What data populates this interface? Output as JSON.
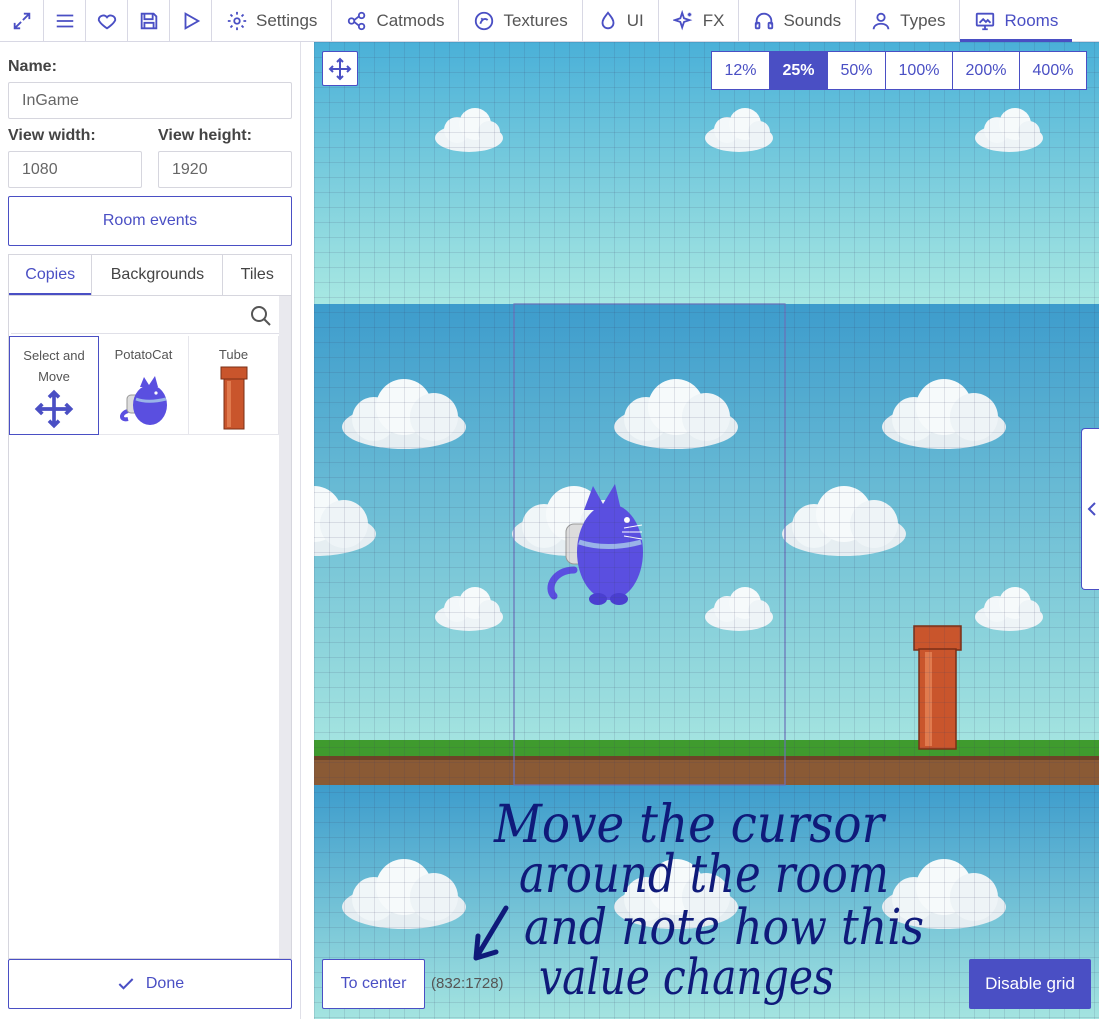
{
  "toolbar": {
    "icons": [
      "expand-icon",
      "menu-icon",
      "heart-icon",
      "save-icon",
      "play-icon"
    ],
    "tabs": [
      {
        "label": "Settings",
        "icon": "gear-icon"
      },
      {
        "label": "Catmods",
        "icon": "modules-icon"
      },
      {
        "label": "Textures",
        "icon": "texture-icon"
      },
      {
        "label": "UI",
        "icon": "droplet-icon"
      },
      {
        "label": "FX",
        "icon": "sparkle-icon"
      },
      {
        "label": "Sounds",
        "icon": "headphones-icon"
      },
      {
        "label": "Types",
        "icon": "user-icon"
      },
      {
        "label": "Rooms",
        "icon": "room-icon",
        "active": true
      }
    ]
  },
  "room": {
    "name_label": "Name:",
    "name_value": "InGame",
    "width_label": "View width:",
    "width_value": "1080",
    "height_label": "View height:",
    "height_value": "1920",
    "events_label": "Room events"
  },
  "palette": {
    "tabs": [
      "Copies",
      "Backgrounds",
      "Tiles"
    ],
    "active_tab": "Copies",
    "search_placeholder": "",
    "items": [
      {
        "label": "Select and Move",
        "icon": "move-icon",
        "selected": true
      },
      {
        "label": "PotatoCat",
        "icon": "potatocat-sprite"
      },
      {
        "label": "Tube",
        "icon": "tube-sprite"
      }
    ]
  },
  "footer": {
    "done_label": "Done",
    "to_center_label": "To center",
    "coords": "(832:1728)",
    "grid_label": "Disable grid"
  },
  "zoom": {
    "levels": [
      "12%",
      "25%",
      "50%",
      "100%",
      "200%",
      "400%"
    ],
    "active": "25%"
  },
  "annotation": {
    "lines": [
      "Move the cursor",
      "around the room",
      "and note how this",
      "value changes"
    ]
  },
  "colors": {
    "accent": "#4a4fc4",
    "sky_top": "#a8e8e2",
    "sky": "#4ab0d8",
    "grass": "#3f9b2e",
    "dirt": "#8a5a35",
    "tube": "#c9552c",
    "cat": "#5a4fe0",
    "ink": "#0f1a7a"
  }
}
